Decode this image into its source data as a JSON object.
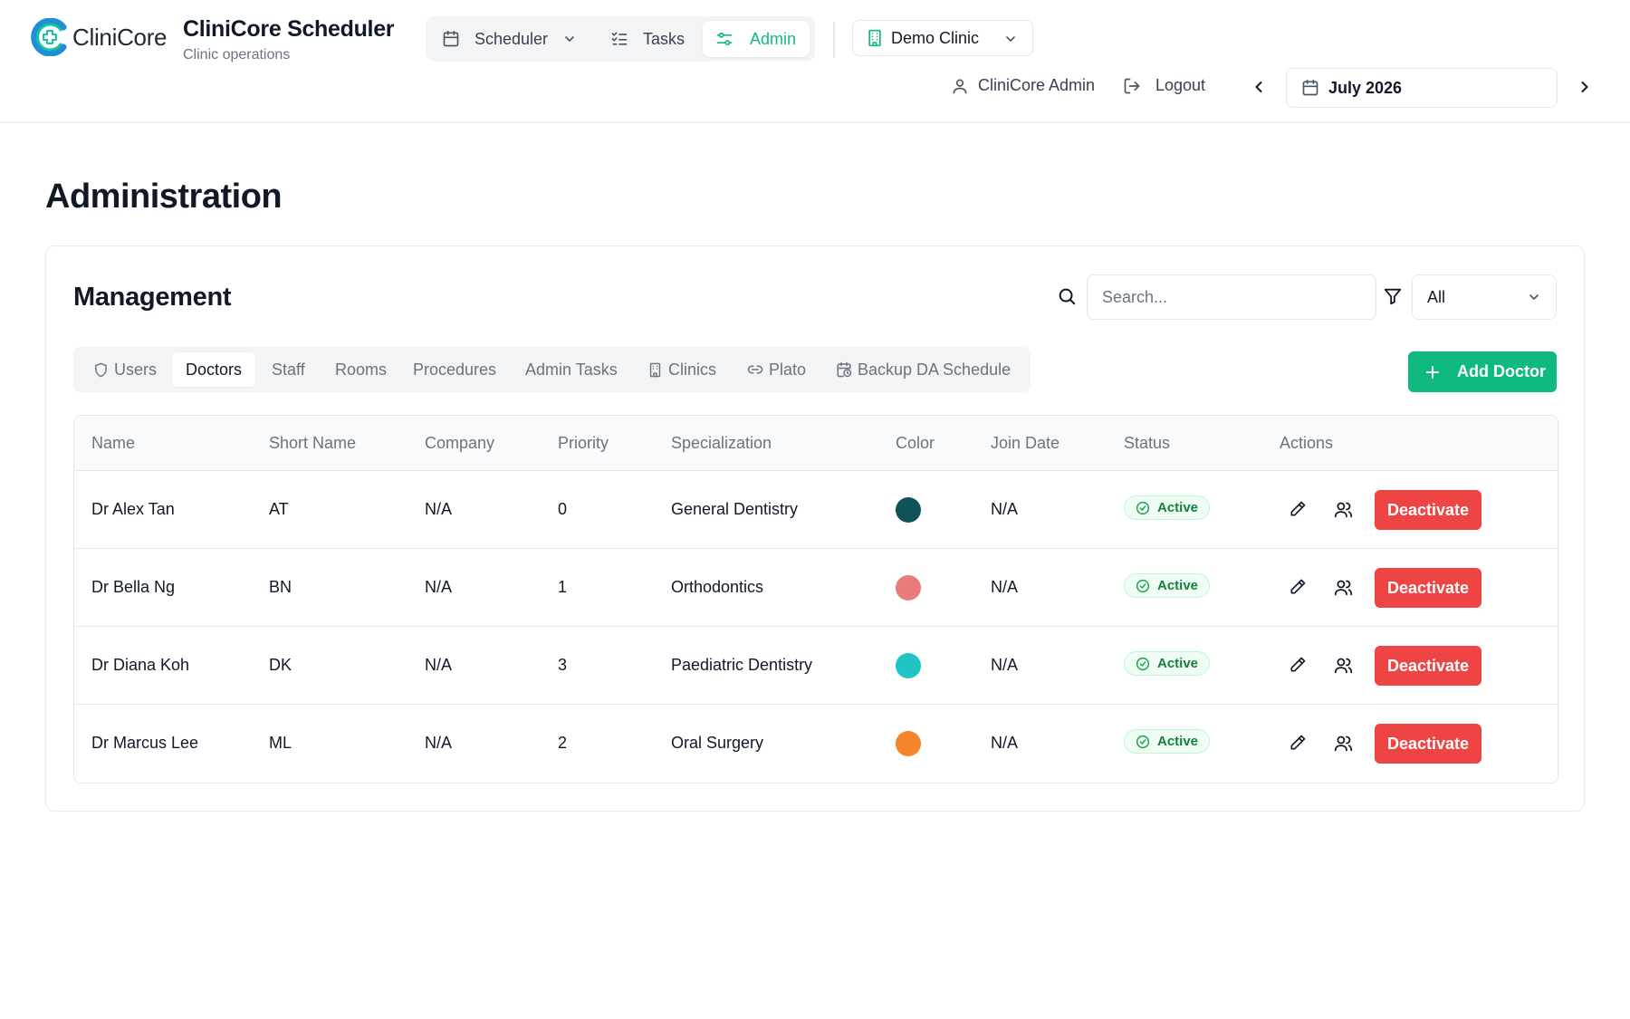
{
  "brand": {
    "logo_text": "CliniCore",
    "title": "CliniCore Scheduler",
    "subtitle": "Clinic operations"
  },
  "nav": {
    "scheduler": "Scheduler",
    "tasks": "Tasks",
    "admin": "Admin"
  },
  "clinic": {
    "selected": "Demo Clinic"
  },
  "user": {
    "name": "CliniCore Admin",
    "logout": "Logout"
  },
  "month": {
    "label": "July 2026"
  },
  "page": {
    "title": "Administration"
  },
  "management": {
    "title": "Management",
    "search_placeholder": "Search...",
    "filter_value": "All",
    "add_button": "Add Doctor",
    "tabs": [
      "Users",
      "Doctors",
      "Staff",
      "Rooms",
      "Procedures",
      "Admin Tasks",
      "Clinics",
      "Plato",
      "Backup DA Schedule"
    ]
  },
  "table": {
    "columns": [
      "Name",
      "Short Name",
      "Company",
      "Priority",
      "Specialization",
      "Color",
      "Join Date",
      "Status",
      "Actions"
    ],
    "rows": [
      {
        "name": "Dr Alex Tan",
        "short": "AT",
        "company": "N/A",
        "priority": "0",
        "specialization": "General Dentistry",
        "color": "#0f5257",
        "join": "N/A",
        "status": "Active",
        "action": "Deactivate"
      },
      {
        "name": "Dr Bella Ng",
        "short": "BN",
        "company": "N/A",
        "priority": "1",
        "specialization": "Orthodontics",
        "color": "#e87c7c",
        "join": "N/A",
        "status": "Active",
        "action": "Deactivate"
      },
      {
        "name": "Dr Diana Koh",
        "short": "DK",
        "company": "N/A",
        "priority": "3",
        "specialization": "Paediatric Dentistry",
        "color": "#20c4c4",
        "join": "N/A",
        "status": "Active",
        "action": "Deactivate"
      },
      {
        "name": "Dr Marcus Lee",
        "short": "ML",
        "company": "N/A",
        "priority": "2",
        "specialization": "Oral Surgery",
        "color": "#f5842a",
        "join": "N/A",
        "status": "Active",
        "action": "Deactivate"
      }
    ]
  },
  "colors": {
    "accent": "#10b981",
    "danger": "#ef4444"
  }
}
